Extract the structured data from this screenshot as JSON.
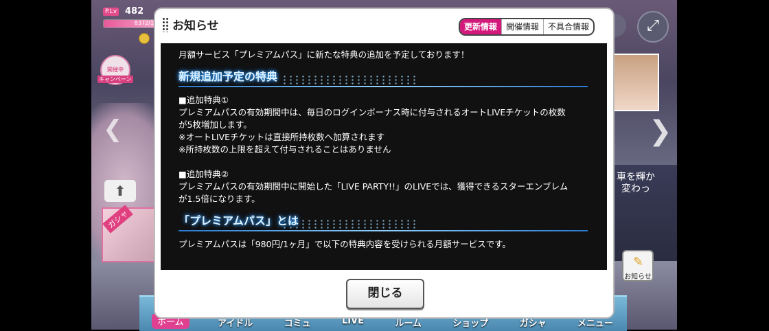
{
  "hud": {
    "plv_label": "P.Lv",
    "plv_value": "482",
    "exp_text": "8372/18",
    "exp_progress": 0.95,
    "campaign_label": "開催中",
    "campaign_sub": "キャンペーン"
  },
  "side": {
    "gacha_label": "ガシャ",
    "right_text": "車を輝か 変わっ",
    "notice_label": "お知らせ"
  },
  "nav": {
    "items": [
      "ホーム",
      "アイドル",
      "コミュ",
      "LIVE",
      "ルーム",
      "ショップ",
      "ガシャ",
      "メニュー"
    ]
  },
  "modal": {
    "title": "お知らせ",
    "tabs": [
      {
        "label": "更新情報",
        "active": true
      },
      {
        "label": "開催情報",
        "active": false
      },
      {
        "label": "不具合情報",
        "active": false
      }
    ],
    "intro": "月額サービス「プレミアムパス」に新たな特典の追加を予定しております！",
    "section1_title": "新規追加予定の特典",
    "bonus1_head": "■追加特典①",
    "bonus1_line1": "プレミアムパスの有効期間中は、毎日のログインボーナス時に付与されるオートLIVEチケットの枚数",
    "bonus1_line2": "が5枚増加します。",
    "bonus1_note1": "※オートLIVEチケットは直接所持枚数へ加算されます",
    "bonus1_note2": "※所持枚数の上限を超えて付与されることはありません",
    "bonus2_head": "■追加特典②",
    "bonus2_line1": "プレミアムパスの有効期間中に開始した「LIVE PARTY!!」のLIVEでは、獲得できるスターエンブレム",
    "bonus2_line2": "が1.5倍になります。",
    "section2_title": "「プレミアムパス」とは",
    "desc_line1": "プレミアムパスは「980円/1ヶ月」で以下の特典内容を受けられる月額サービスです。",
    "close_label": "閉じる"
  }
}
